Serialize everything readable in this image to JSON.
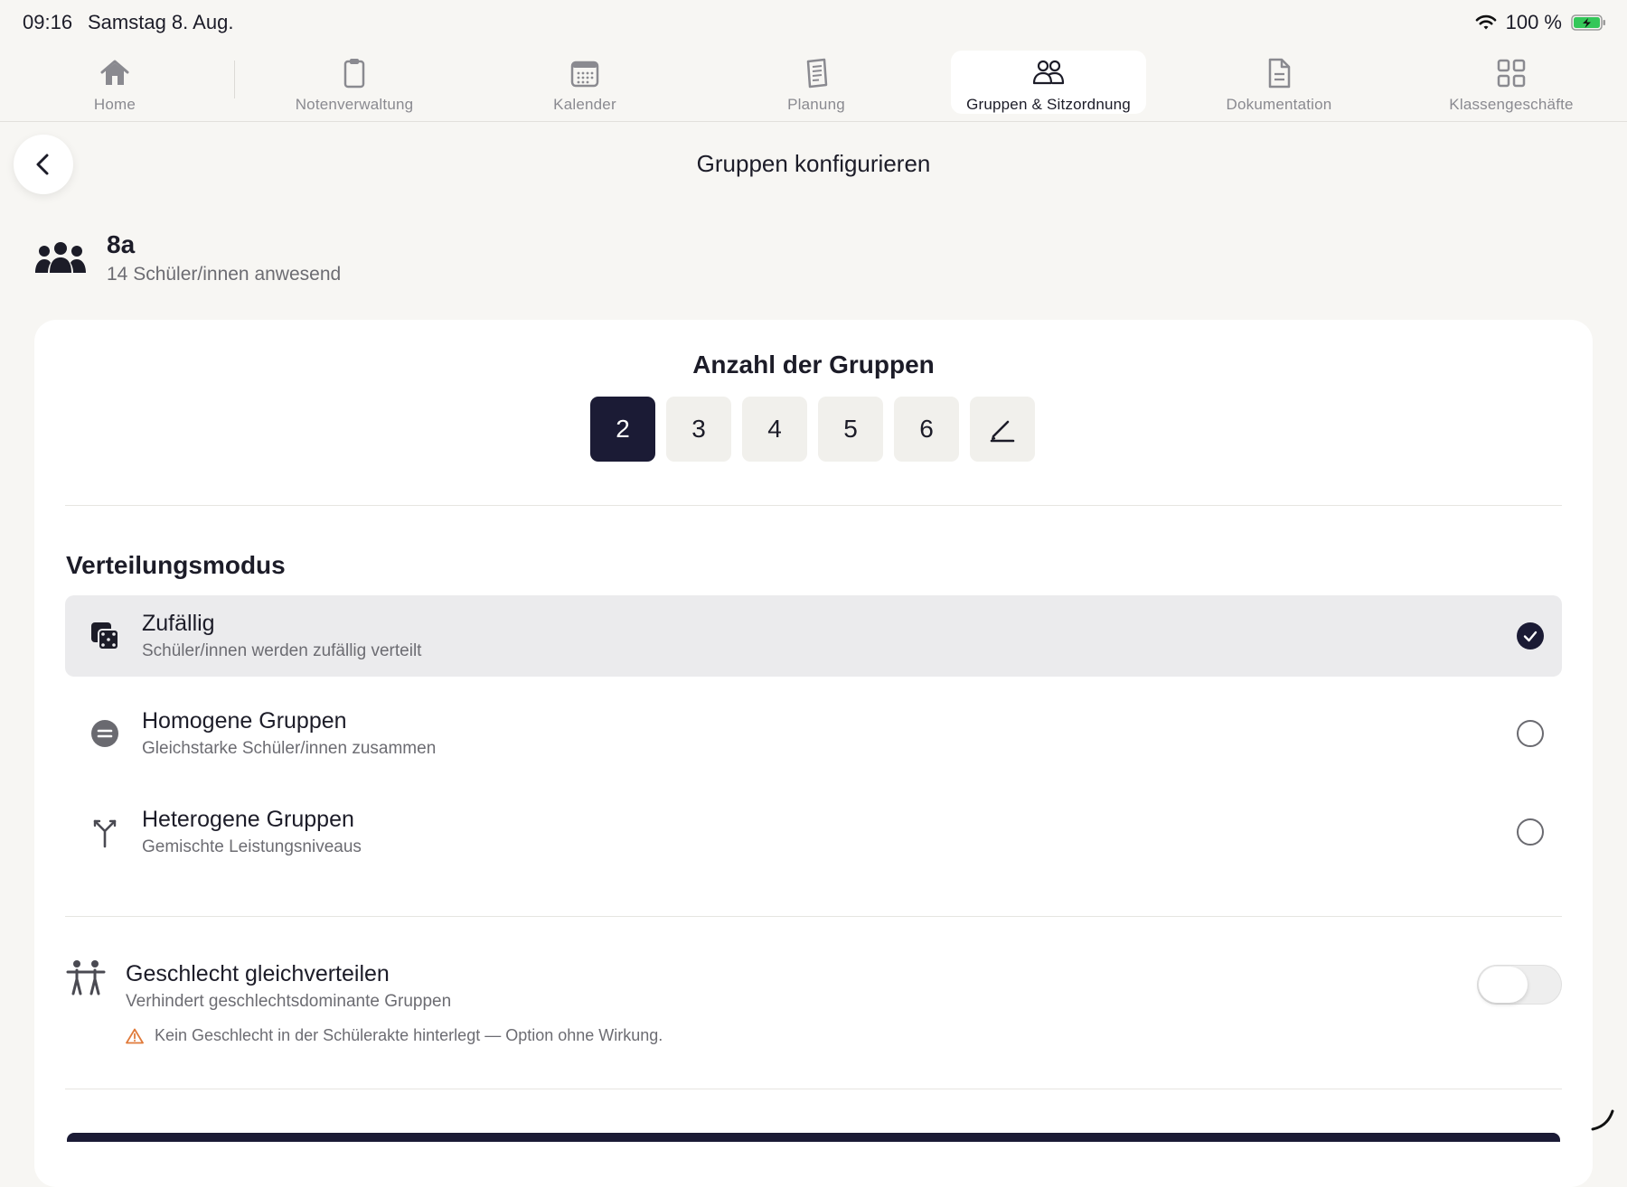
{
  "status_bar": {
    "time": "09:16",
    "date": "Samstag 8. Aug.",
    "battery": "100 %"
  },
  "tabs": [
    {
      "label": "Home",
      "icon": "home-icon"
    },
    {
      "label": "Notenverwaltung",
      "icon": "clipboard-icon"
    },
    {
      "label": "Kalender",
      "icon": "calendar-icon"
    },
    {
      "label": "Planung",
      "icon": "notes-icon"
    },
    {
      "label": "Gruppen & Sitzordnung",
      "icon": "people-icon",
      "active": true
    },
    {
      "label": "Dokumentation",
      "icon": "document-icon"
    },
    {
      "label": "Klassengeschäfte",
      "icon": "grid-icon"
    }
  ],
  "header": {
    "title": "Gruppen konfigurieren"
  },
  "class_info": {
    "name": "8a",
    "subtitle": "14 Schüler/innen anwesend"
  },
  "group_count": {
    "title": "Anzahl der Gruppen",
    "options": [
      "2",
      "3",
      "4",
      "5",
      "6"
    ],
    "selected": "2"
  },
  "distribution": {
    "title": "Verteilungsmodus",
    "modes": [
      {
        "title": "Zufällig",
        "subtitle": "Schüler/innen werden zufällig verteilt",
        "icon": "dice-icon",
        "selected": true
      },
      {
        "title": "Homogene Gruppen",
        "subtitle": "Gleichstarke Schüler/innen zusammen",
        "icon": "equals-icon",
        "selected": false
      },
      {
        "title": "Heterogene Gruppen",
        "subtitle": "Gemischte Leistungsniveaus",
        "icon": "split-icon",
        "selected": false
      }
    ]
  },
  "gender_option": {
    "title": "Geschlecht gleichverteilen",
    "subtitle": "Verhindert geschlechtsdominante Gruppen",
    "warning": "Kein Geschlecht in der Schülerakte hinterlegt — Option ohne Wirkung.",
    "enabled": false
  },
  "colors": {
    "accent": "#1b1b35",
    "background": "#f7f6f3",
    "warning": "#e07a3a",
    "battery": "#34c759"
  }
}
